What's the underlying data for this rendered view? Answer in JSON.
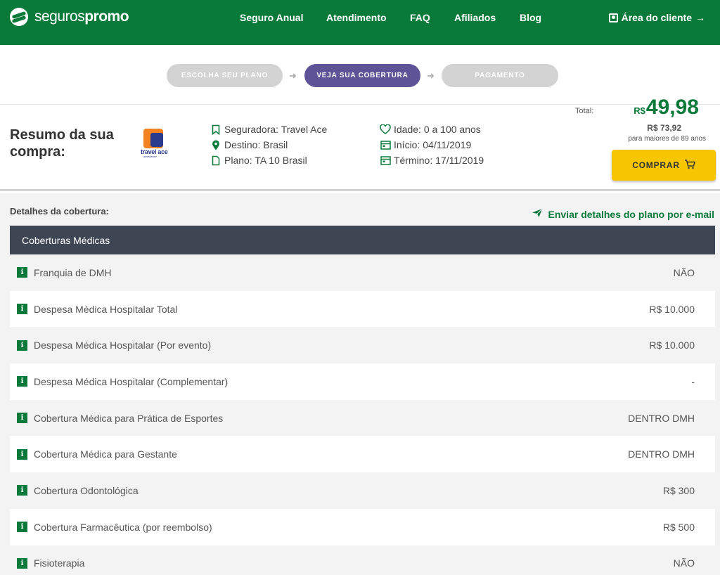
{
  "header": {
    "logo_part1": "seguros",
    "logo_part2": "promo",
    "nav": [
      "Seguro Anual",
      "Atendimento",
      "FAQ",
      "Afiliados",
      "Blog"
    ],
    "client_area": "Área do cliente",
    "client_arrow": "→",
    "colors": {
      "brand": "#0a7a3b"
    }
  },
  "steps": [
    {
      "label": "ESCOLHA SEU PLANO",
      "active": false
    },
    {
      "label": "VEJA SUA COBERTURA",
      "active": true
    },
    {
      "label": "PAGAMENTO",
      "active": false
    }
  ],
  "summary": {
    "title": "Resumo da sua compra:",
    "insurer_logo_text": "travel ace",
    "insurer_logo_sub": "assistance",
    "details_left": [
      {
        "icon": "bookmark-icon",
        "text": "Seguradora: Travel Ace"
      },
      {
        "icon": "location-pin-icon",
        "text": "Destino: Brasil"
      },
      {
        "icon": "document-icon",
        "text": "Plano: TA 10 Brasil"
      }
    ],
    "details_right": [
      {
        "icon": "heart-icon",
        "text": "Idade: 0 a 100 anos"
      },
      {
        "icon": "calendar-icon",
        "text": "Início: 04/11/2019"
      },
      {
        "icon": "calendar-icon",
        "text": "Término: 17/11/2019"
      }
    ],
    "total_label": "Total:",
    "currency": "R$",
    "price": "49,98",
    "price_senior": "R$ 73,92",
    "price_note": "para maiores de 89 anos",
    "buy_label": "COMPRAR"
  },
  "details": {
    "label": "Detalhes da cobertura:",
    "email_link": "Enviar detalhes do plano por e-mail",
    "section_title": "Coberturas Médicas",
    "rows": [
      {
        "name": "Franquia de DMH",
        "value": "NÃO"
      },
      {
        "name": "Despesa Médica Hospitalar Total",
        "value": "R$ 10.000"
      },
      {
        "name": "Despesa Médica Hospitalar (Por evento)",
        "value": "R$ 10.000"
      },
      {
        "name": "Despesa Médica Hospitalar (Complementar)",
        "value": "-"
      },
      {
        "name": "Cobertura Médica para Prática de Esportes",
        "value": "DENTRO DMH"
      },
      {
        "name": "Cobertura Médica para Gestante",
        "value": "DENTRO DMH"
      },
      {
        "name": "Cobertura Odontológica",
        "value": "R$ 300"
      },
      {
        "name": "Cobertura Farmacêutica (por reembolso)",
        "value": "R$ 500"
      },
      {
        "name": "Fisioterapia",
        "value": "NÃO"
      }
    ]
  }
}
